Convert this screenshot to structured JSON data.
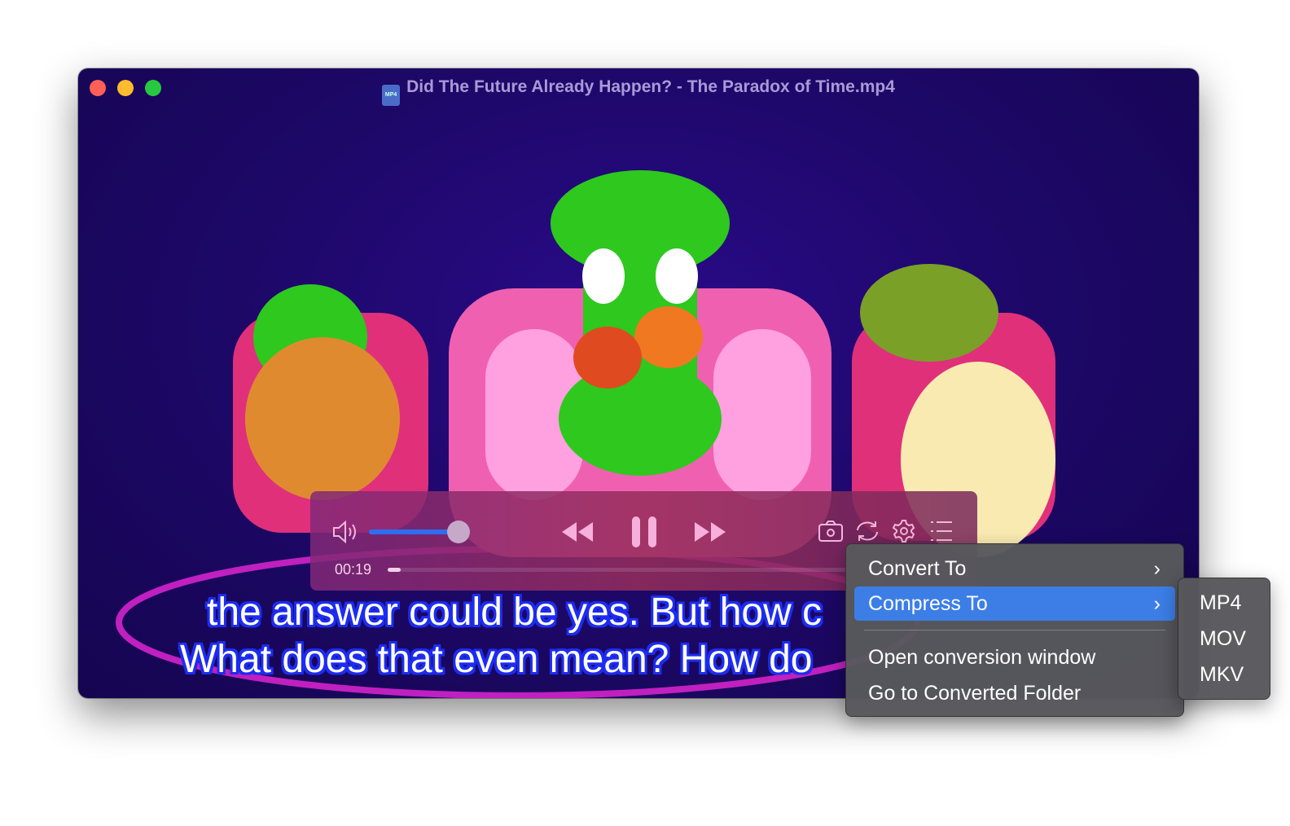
{
  "window": {
    "title": "Did The Future Already Happen?  - The Paradox of Time.mp4",
    "file_badge": "MP4"
  },
  "colors": {
    "accent": "#3c7ee6",
    "subtitle_outline": "#1d2cf0",
    "background": "#1d0868"
  },
  "player": {
    "elapsed": "00:19",
    "volume_fraction": 1.0,
    "progress_fraction": 0.02,
    "state": "playing"
  },
  "subtitles": {
    "line1": "the answer could be yes. But how c",
    "line2": "What does that even mean? How do"
  },
  "menu": {
    "items": [
      {
        "label": "Convert To",
        "submenu": true
      },
      {
        "label": "Compress To",
        "submenu": true,
        "highlighted": true
      },
      {
        "label": "Open conversion window"
      },
      {
        "label": "Go to Converted Folder"
      }
    ]
  },
  "submenu": {
    "items": [
      "MP4",
      "MOV",
      "MKV"
    ]
  }
}
